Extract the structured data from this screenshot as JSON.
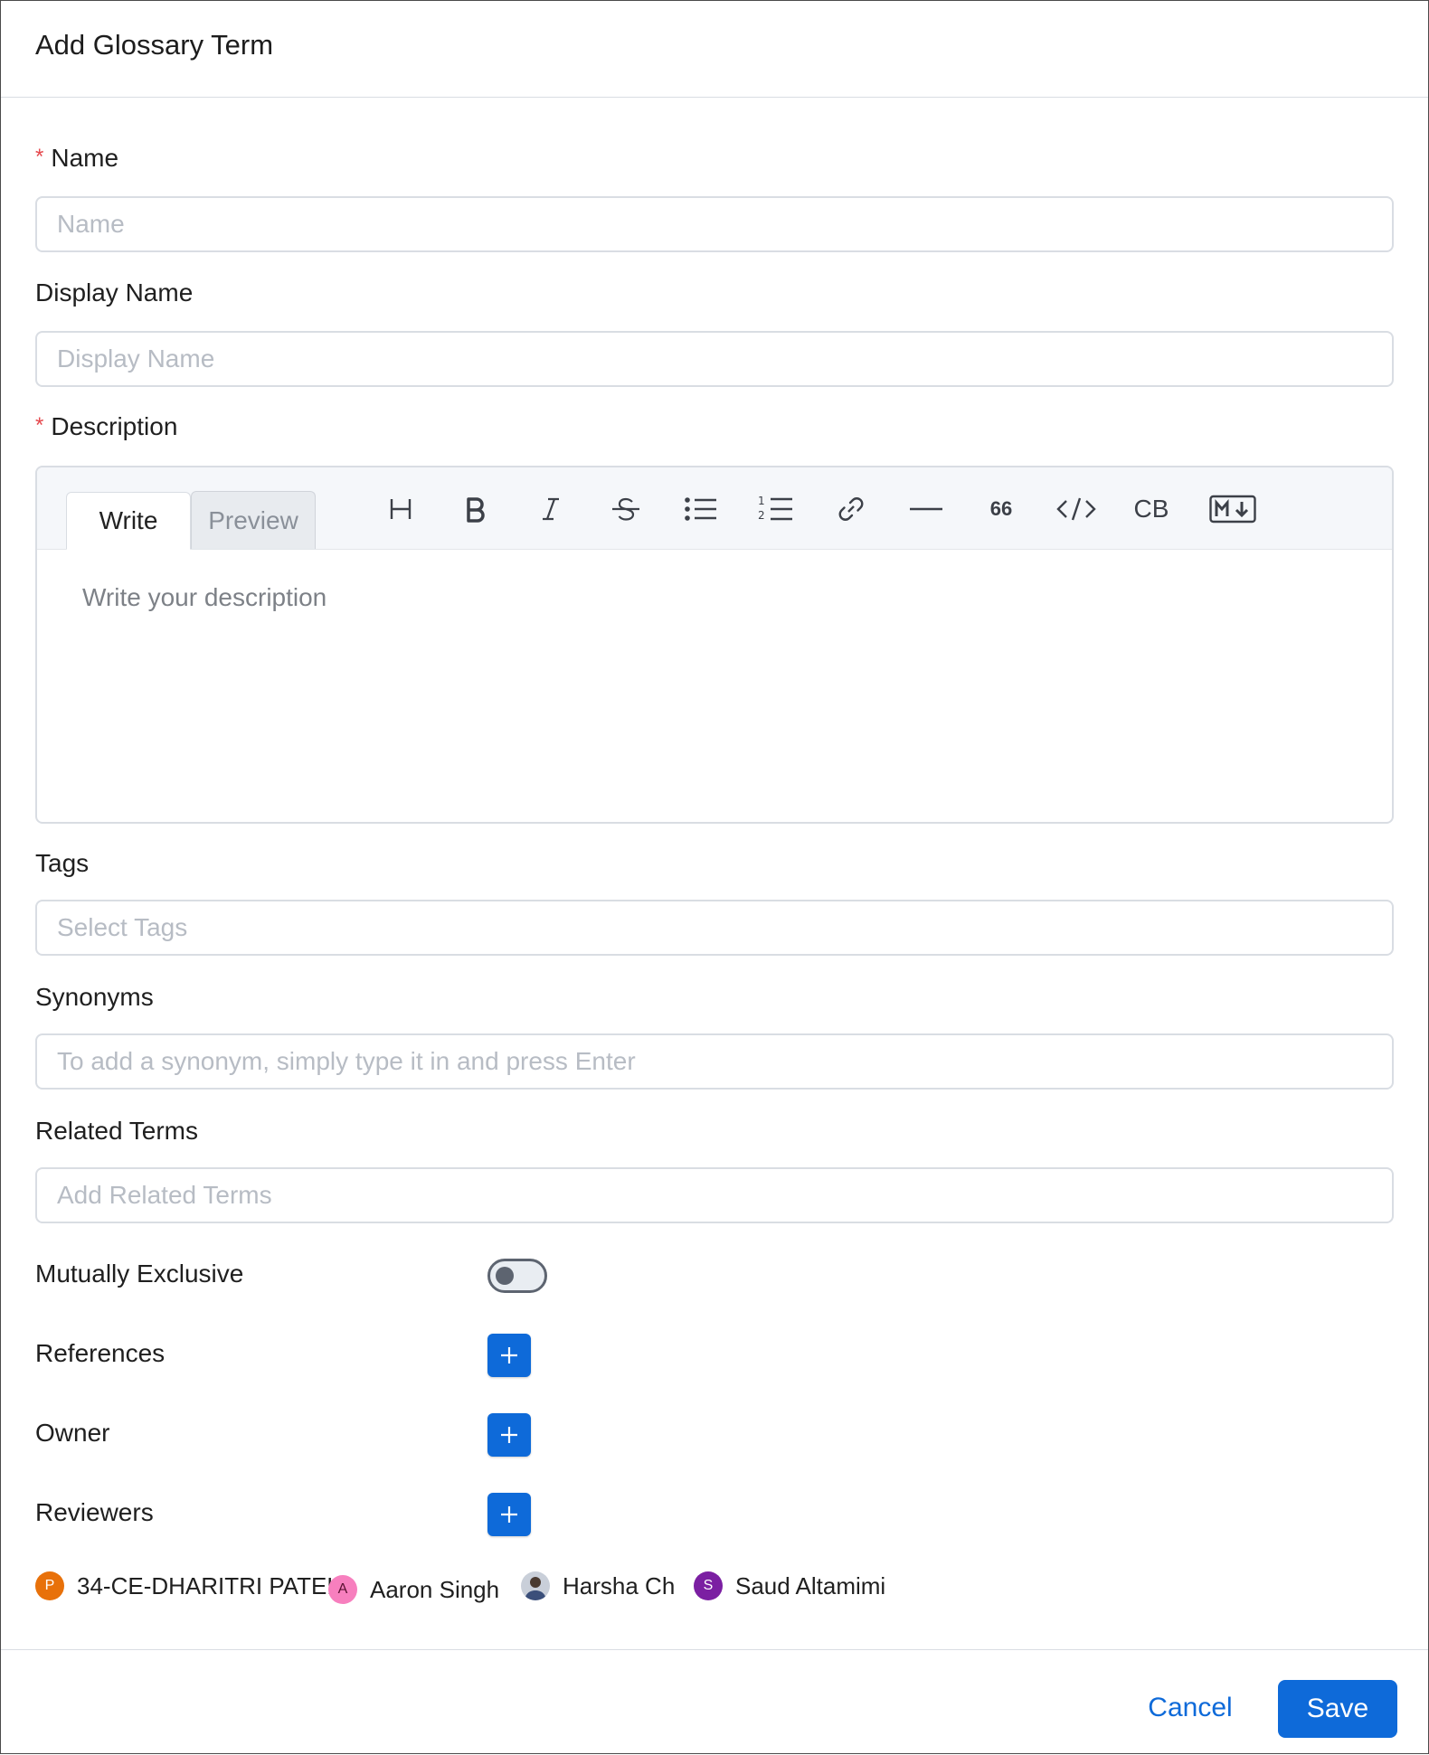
{
  "dialog": {
    "title": "Add Glossary Term"
  },
  "form": {
    "name": {
      "label": "Name",
      "required_mark": "*",
      "placeholder": "Name",
      "value": ""
    },
    "display_name": {
      "label": "Display Name",
      "placeholder": "Display Name",
      "value": ""
    },
    "description": {
      "label": "Description",
      "required_mark": "*",
      "tabs": [
        "Write",
        "Preview"
      ],
      "active_tab": "Write",
      "toolbar": [
        {
          "name": "heading",
          "glyph": "H"
        },
        {
          "name": "bold",
          "glyph": "B"
        },
        {
          "name": "italic",
          "glyph": "I"
        },
        {
          "name": "strikethrough",
          "glyph": "S"
        },
        {
          "name": "bullet-list",
          "glyph": ""
        },
        {
          "name": "numbered-list",
          "glyph": ""
        },
        {
          "name": "link",
          "glyph": ""
        },
        {
          "name": "horizontal-rule",
          "glyph": ""
        },
        {
          "name": "quote",
          "glyph": "66"
        },
        {
          "name": "code",
          "glyph": "</>"
        },
        {
          "name": "code-block",
          "glyph": "CB"
        },
        {
          "name": "markdown",
          "glyph": "M"
        }
      ],
      "placeholder": "Write your description"
    },
    "tags": {
      "label": "Tags",
      "placeholder": "Select Tags"
    },
    "synonyms": {
      "label": "Synonyms",
      "placeholder": "To add a synonym, simply type it in and press Enter"
    },
    "related_terms": {
      "label": "Related Terms",
      "placeholder": "Add Related Terms"
    },
    "mutually_exclusive": {
      "label": "Mutually Exclusive",
      "checked": false
    },
    "references": {
      "label": "References"
    },
    "owner": {
      "label": "Owner"
    },
    "reviewers": {
      "label": "Reviewers",
      "list": [
        {
          "initial": "P",
          "name": "34-CE-DHARITRI PATEL",
          "color": "#e8710a"
        },
        {
          "initial": "A",
          "name": "Aaron Singh",
          "color": "#f77fbe"
        },
        {
          "initial": "",
          "name": "Harsha Ch",
          "color": "#4a5a78"
        },
        {
          "initial": "S",
          "name": "Saud Altamimi",
          "color": "#7b1fa2"
        }
      ]
    }
  },
  "footer": {
    "cancel_label": "Cancel",
    "save_label": "Save"
  },
  "colors": {
    "primary": "#0e6ad9",
    "required": "#e5484d",
    "border": "#d9dde3"
  }
}
